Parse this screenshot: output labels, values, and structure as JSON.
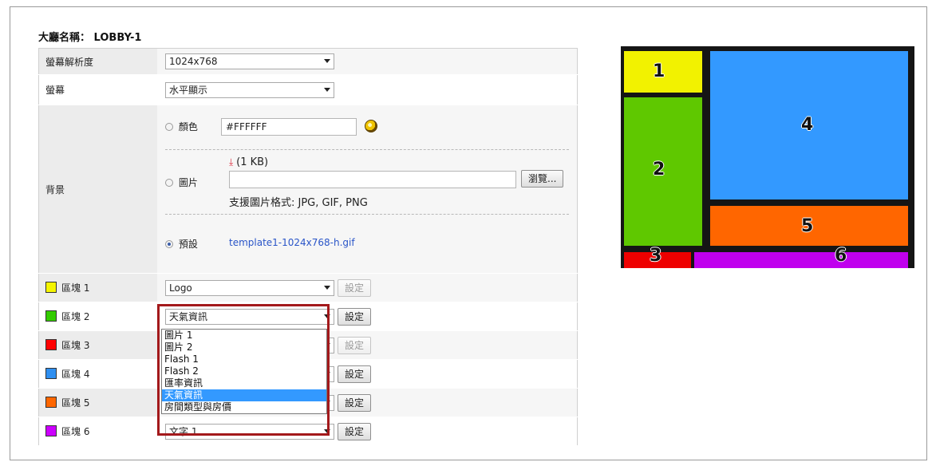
{
  "lobby": {
    "label": "大廳名稱：",
    "name": "LOBBY-1"
  },
  "rows": {
    "resolution": {
      "label": "螢幕解析度",
      "value": "1024x768"
    },
    "screen": {
      "label": "螢幕",
      "value": "水平顯示"
    },
    "background": {
      "label": "背景",
      "color_option": {
        "label": "顏色",
        "value": "#FFFFFF",
        "selected": false
      },
      "image_option": {
        "label": "圖片",
        "size": "(1 KB)",
        "browse": "瀏覽...",
        "hint": "支援圖片格式: JPG, GIF, PNG",
        "selected": false
      },
      "default_option": {
        "label": "預設",
        "file": "template1-1024x768-h.gif",
        "selected": true
      }
    }
  },
  "blocks": [
    {
      "label": "區塊 1",
      "color": "#f5f500",
      "value": "Logo",
      "button": "設定",
      "enabled": false
    },
    {
      "label": "區塊 2",
      "color": "#33cc00",
      "value": "天氣資訊",
      "button": "設定",
      "enabled": true
    },
    {
      "label": "區塊 3",
      "color": "#ff0000",
      "value": "",
      "button": "設定",
      "enabled": false
    },
    {
      "label": "區塊 4",
      "color": "#2f8ff0",
      "value": "",
      "button": "設定",
      "enabled": true
    },
    {
      "label": "區塊 5",
      "color": "#ff6600",
      "value": "",
      "button": "設定",
      "enabled": true
    },
    {
      "label": "區塊 6",
      "color": "#cc00ff",
      "value": "文字 1",
      "button": "設定",
      "enabled": true
    }
  ],
  "dropdown_options": [
    "圖片 1",
    "圖片 2",
    "Flash 1",
    "Flash 2",
    "匯率資訊",
    "天氣資訊",
    "房間類型與房價"
  ],
  "dropdown_highlight": "天氣資訊",
  "preview": {
    "zones": [
      {
        "number": "1",
        "color": "#f2f200"
      },
      {
        "number": "2",
        "color": "#5fc800"
      },
      {
        "number": "3",
        "color": "#ee0000"
      },
      {
        "number": "4",
        "color": "#3399ff"
      },
      {
        "number": "5",
        "color": "#ff6600"
      },
      {
        "number": "6",
        "color": "#c000ee"
      }
    ]
  }
}
